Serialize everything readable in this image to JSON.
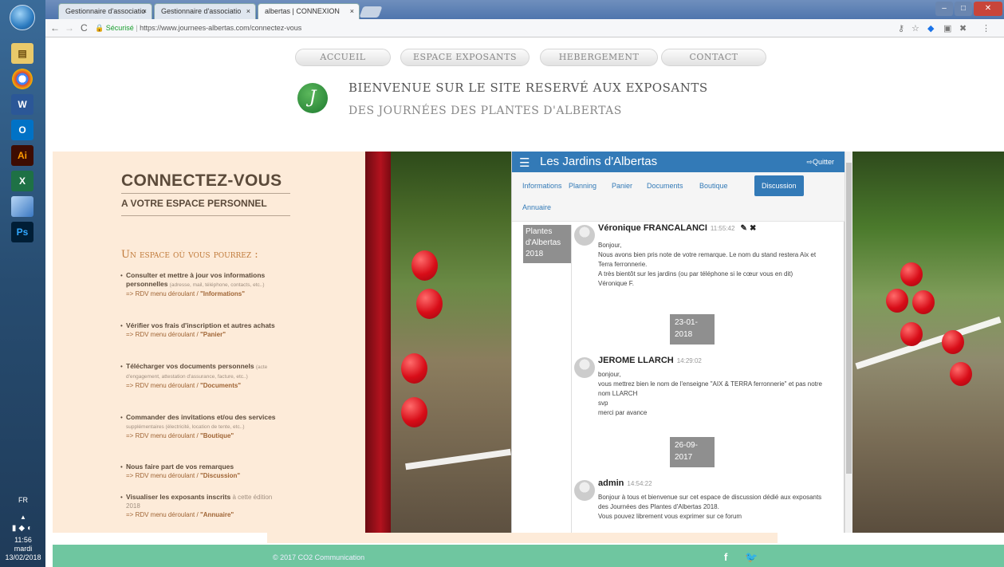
{
  "taskbar": {
    "icons": [
      "W",
      "O",
      "Ai",
      "X",
      "Ps"
    ],
    "tray_lang": "FR",
    "clock_time": "11:56",
    "clock_day": "mardi",
    "clock_date": "13/02/2018"
  },
  "browser": {
    "tabs": [
      {
        "label": "Gestionnaire d'associatio"
      },
      {
        "label": "Gestionnaire d'associatio"
      },
      {
        "label": "albertas | CONNEXION"
      }
    ],
    "secure_label": "Sécurisé",
    "url": "https://www.journees-albertas.com/connectez-vous"
  },
  "site": {
    "nav": [
      "ACCUEIL",
      "ESPACE EXPOSANTS",
      "HEBERGEMENT",
      "CONTACT"
    ],
    "logo_letter": "J",
    "welcome_line1": "BIENVENUE SUR LE SITE RESERVÉ AUX EXPOSANTS",
    "welcome_line2": "DES JOURNÉES DES PLANTES D'ALBERTAS"
  },
  "login_panel": {
    "title": "CONNECTEZ-VOUS",
    "subtitle": "A VOTRE ESPACE PERSONNEL",
    "section_title": "Un espace où vous pourrez :",
    "features": [
      {
        "bold": "Consulter et mettre à jour vos informations personnelles",
        "small": "(adresse, mail, téléphone, contacts, etc..)",
        "route_prefix": "=> RDV menu déroulant / ",
        "route": "\"Informations\""
      },
      {
        "bold": "Vérifier vos frais d'inscription et autres achats",
        "small": "",
        "route_prefix": "=> RDV menu déroulant / ",
        "route": "\"Panier\""
      },
      {
        "bold": "Télécharger vos documents personnels",
        "small": "(acte d'engagement, attestation d'assurance, facture, etc..)",
        "route_prefix": "=> RDV menu déroulant / ",
        "route": "\"Documents\""
      },
      {
        "bold": "Commander des invitations et/ou des services",
        "small": "supplémentaires (électricité, location de tente, etc..)",
        "route_prefix": "=> RDV menu déroulant / ",
        "route": "\"Boutique\""
      },
      {
        "bold": "Nous faire part de vos remarques",
        "small": "",
        "route_prefix": "=> RDV menu déroulant / ",
        "route": "\"Discussion\""
      },
      {
        "bold": "Visualiser les exposants inscrits",
        "small": "à cette édition 2018",
        "route_prefix": "=> RDV menu déroulant / ",
        "route": "\"Annuaire\""
      }
    ]
  },
  "app": {
    "title": "Les Jardins d'Albertas",
    "quit_label": "Quitter",
    "tabs": [
      "Informations",
      "Planning",
      "Panier",
      "Documents",
      "Boutique",
      "Discussion",
      "Annuaire"
    ],
    "active_tab": "Discussion",
    "conversation": "Plantes d'Albertas 2018",
    "messages": [
      {
        "author": "Véronique FRANCALANCI",
        "time": "11:55:42",
        "lines": [
          "Bonjour,",
          "Nous avons bien pris note de votre remarque. Le nom du stand restera Aix et Terra ferronnerie.",
          "A très bientôt sur les jardins (ou par téléphone si le cœur vous en dit)",
          "Véronique F."
        ]
      },
      {
        "date": "23-01-2018"
      },
      {
        "author": "JEROME LLARCH",
        "time": "14:29:02",
        "lines": [
          "bonjour,",
          "vous mettrez bien le nom de l'enseigne \"AIX & TERRA ferronnerie\" et pas notre nom LLARCH",
          "svp",
          "merci par avance"
        ]
      },
      {
        "date": "26-09-2017"
      },
      {
        "author": "admin",
        "time": "14:54:22",
        "lines": [
          "Bonjour à tous et bienvenue sur cet espace de discussion dédié aux exposants des Journées des Plantes d'Albertas 2018.",
          "Vous pouvez librement vous exprimer sur ce forum"
        ]
      }
    ]
  },
  "footer": {
    "copyright": "© 2017 CO2 Communication"
  },
  "colors": {
    "app_blue": "#337ab7",
    "panel_beige": "#fdebd9",
    "footer_green": "#6fc6a0",
    "date_badge": "#8f8f8f"
  }
}
